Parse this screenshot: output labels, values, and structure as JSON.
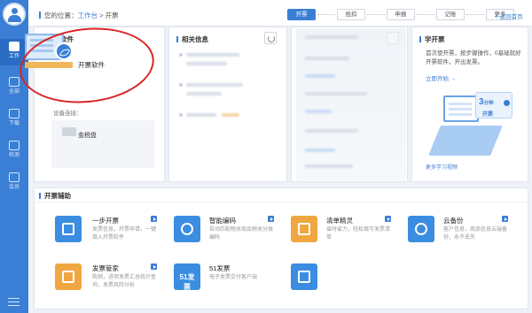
{
  "sidebar": {
    "items": [
      {
        "label": "工作",
        "icon": "monitor-icon"
      },
      {
        "label": "全部",
        "icon": "document-icon"
      },
      {
        "label": "下载",
        "icon": "download-icon"
      },
      {
        "label": "检测",
        "icon": "chart-icon"
      },
      {
        "label": "会员",
        "icon": "trophy-icon"
      }
    ]
  },
  "breadcrumb": {
    "prefix": "您的位置：",
    "link": "工作台",
    "separator": " > ",
    "current": "开票"
  },
  "steps": [
    "开票",
    "抵扣",
    "申报",
    "记账",
    "更多"
  ],
  "back_home": "< 返回首页",
  "card1": {
    "title": "开票软件",
    "app_name": "开票软件",
    "device_label": "设备连接：",
    "device_name": "金税盘"
  },
  "card2": {
    "title": "相关信息"
  },
  "learn": {
    "title": "学开票",
    "text": "首次使开票，按步骤操作，0基础就好开票软件，开出发票。",
    "start": "立即开始 →",
    "minutes": "3",
    "minutes_unit": "分钟",
    "sub": "开票",
    "more": "更多学习视频"
  },
  "assist": {
    "title": "开票辅助",
    "tools": [
      {
        "name": "一步开票",
        "desc": "发票信息，开票申请，一键填入开票软件",
        "color": "#3a8de0",
        "icon": "printer-icon"
      },
      {
        "name": "智能编码",
        "desc": "自动匹配税收商品税收分类编码",
        "color": "#3a8de0",
        "icon": "code-icon"
      },
      {
        "name": "清单精灵",
        "desc": "省时省力，轻松填写发票清单",
        "color": "#f0a742",
        "icon": "list-icon"
      },
      {
        "name": "云备份",
        "desc": "客户信息，商品信息云端备份，永不丢失",
        "color": "#3a8de0",
        "icon": "cloud-upload-icon"
      },
      {
        "name": "发票管家",
        "desc": "购销，进项发票汇总统计查询，发票风险分析",
        "color": "#f0a742",
        "icon": "manager-icon"
      },
      {
        "name": "51发票",
        "desc": "电子发票交付客户端",
        "color": "#3a8de0",
        "icon": "51-logo-icon",
        "glyph_text": "51发票"
      },
      {
        "name": "",
        "desc": "",
        "color": "#3a8de0",
        "icon": "edit-icon"
      }
    ]
  }
}
